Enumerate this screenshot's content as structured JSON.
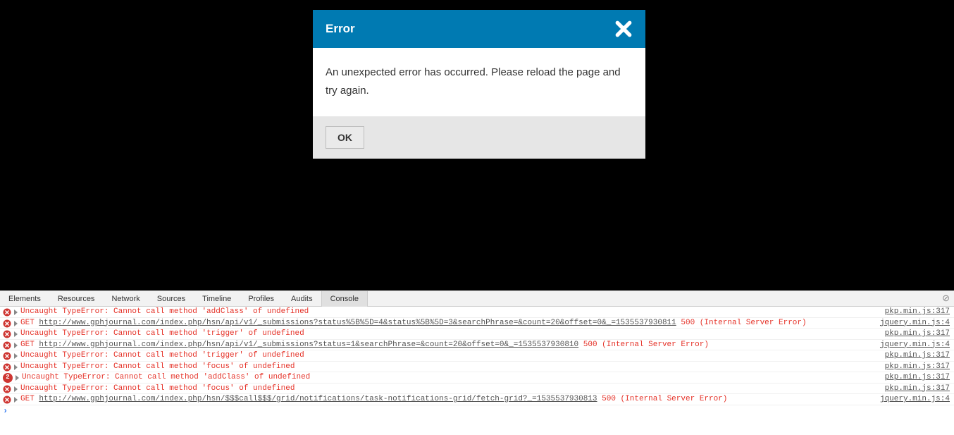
{
  "modal": {
    "title": "Error",
    "body": "An unexpected error has occurred. Please reload the page and try again.",
    "ok": "OK"
  },
  "devtools": {
    "tabs": [
      "Elements",
      "Resources",
      "Network",
      "Sources",
      "Timeline",
      "Profiles",
      "Audits",
      "Console"
    ],
    "active_tab": "Console"
  },
  "console": {
    "badge_count": "2",
    "lines": [
      {
        "type": "err",
        "text": "Uncaught TypeError: Cannot call method 'addClass' of undefined",
        "src": "pkp.min.js:317"
      },
      {
        "type": "get",
        "prefix": "GET ",
        "url": "http://www.gphjournal.com/index.php/hsn/api/v1/_submissions?status%5B%5D=4&status%5B%5D=3&searchPhrase=&count=20&offset=0&_=1535537930811",
        "status": " 500 (Internal Server Error)",
        "src": "jquery.min.js:4"
      },
      {
        "type": "err",
        "text": "Uncaught TypeError: Cannot call method 'trigger' of undefined",
        "src": "pkp.min.js:317"
      },
      {
        "type": "get",
        "prefix": "GET ",
        "url": "http://www.gphjournal.com/index.php/hsn/api/v1/_submissions?status=1&searchPhrase=&count=20&offset=0&_=1535537930810",
        "status": " 500 (Internal Server Error)",
        "src": "jquery.min.js:4"
      },
      {
        "type": "err",
        "text": "Uncaught TypeError: Cannot call method 'trigger' of undefined",
        "src": "pkp.min.js:317"
      },
      {
        "type": "err",
        "text": "Uncaught TypeError: Cannot call method 'focus' of undefined",
        "src": "pkp.min.js:317"
      },
      {
        "type": "err",
        "badge": true,
        "text": "Uncaught TypeError: Cannot call method 'addClass' of undefined",
        "src": "pkp.min.js:317"
      },
      {
        "type": "err",
        "text": "Uncaught TypeError: Cannot call method 'focus' of undefined",
        "src": "pkp.min.js:317"
      },
      {
        "type": "get",
        "prefix": "GET ",
        "url": "http://www.gphjournal.com/index.php/hsn/$$$call$$$/grid/notifications/task-notifications-grid/fetch-grid?_=1535537930813",
        "status": " 500 (Internal Server Error)",
        "src": "jquery.min.js:4"
      }
    ]
  }
}
